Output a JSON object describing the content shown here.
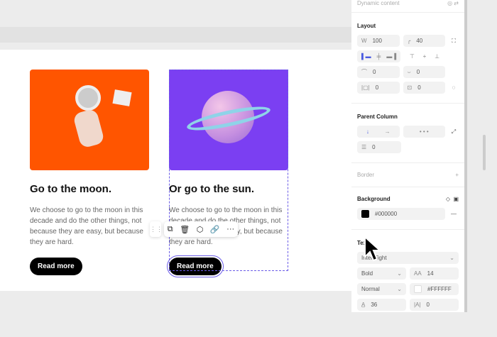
{
  "cards": [
    {
      "title": "Go to the moon.",
      "body": "We choose to go to the moon in this decade and do the other things, not because they are easy, but because they are hard.",
      "button": "Read more",
      "color": "#ff5500"
    },
    {
      "title": "Or go to the sun.",
      "body": "We choose to go to the moon in this decade and do the other things, not because they are easy, but because they are hard.",
      "button": "Read more",
      "color": "#7b3ff2"
    }
  ],
  "toolbar": {
    "icons": [
      "duplicate-icon",
      "trash-icon",
      "component-icon",
      "link-icon",
      "more-icon"
    ],
    "more": "···"
  },
  "panel": {
    "dynamic": "Dynamic content",
    "layout": {
      "title": "Layout",
      "w_label": "W",
      "width": "100",
      "radius": "40",
      "pad_top": "0",
      "pad_bottom": "0",
      "pad_side": "0",
      "pad_v": "0"
    },
    "parent": {
      "title": "Parent Column",
      "dots": "•   •   •",
      "gap": "0"
    },
    "border": {
      "title": "Border"
    },
    "background": {
      "title": "Background",
      "color": "#000000"
    },
    "text": {
      "title": "Text",
      "font": "Inter Tight",
      "weight": "Bold",
      "size_label": "AA",
      "size": "14",
      "style": "Normal",
      "color": "#FFFFFF",
      "line_height": "36",
      "letter_label": "|A|",
      "letter_spacing": "0"
    }
  }
}
